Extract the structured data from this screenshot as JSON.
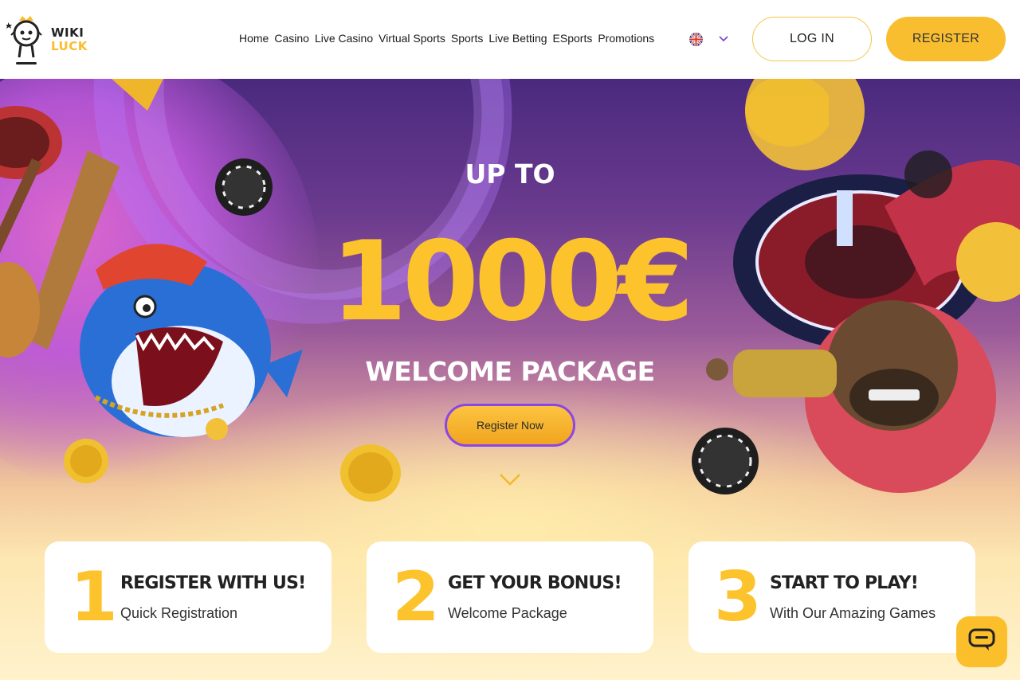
{
  "brand": {
    "line1": "WIKI",
    "line2": "LUCK"
  },
  "nav": {
    "items": [
      "Home",
      "Casino",
      "Live Casino",
      "Virtual Sports",
      "Sports",
      "Live Betting",
      "ESports",
      "Promotions"
    ]
  },
  "language": {
    "icon": "uk-flag-icon"
  },
  "header_buttons": {
    "login": "LOG IN",
    "register": "REGISTER"
  },
  "hero": {
    "title_top": "UP TO",
    "amount": "1000€",
    "title_bottom": "WELCOME PACKAGE",
    "cta": "Register Now"
  },
  "steps": [
    {
      "number": "1",
      "title": "REGISTER WITH US!",
      "subtitle": "Quick Registration"
    },
    {
      "number": "2",
      "title": "GET YOUR BONUS!",
      "subtitle": "Welcome Package"
    },
    {
      "number": "3",
      "title": "START TO PLAY!",
      "subtitle": "With Our Amazing Games"
    }
  ],
  "colors": {
    "accent": "#fcc32d",
    "button": "#f9be30",
    "hero_top": "#4a2a7e",
    "cta_border": "#8a46e8"
  }
}
